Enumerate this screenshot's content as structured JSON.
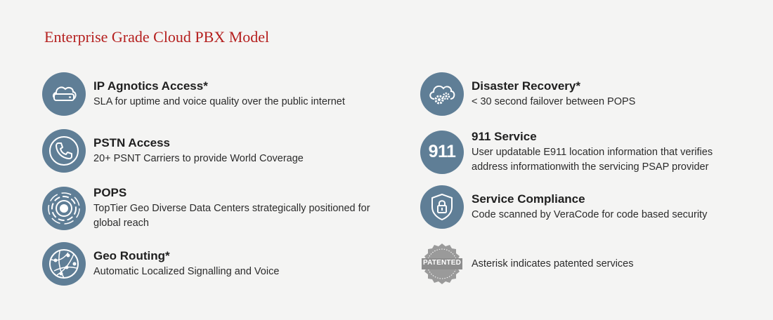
{
  "page": {
    "title": "Enterprise Grade Cloud PBX Model"
  },
  "features_left": [
    {
      "icon": "cloud-drive-icon",
      "heading": "IP Agnotics Access*",
      "description": "SLA for uptime and voice quality over the public internet"
    },
    {
      "icon": "phone-icon",
      "heading": "PSTN Access",
      "description": "20+ PSNT Carriers to provide World Coverage"
    },
    {
      "icon": "radar-target-icon",
      "heading": "POPS",
      "description": "TopTier Geo Diverse Data Centers strategically positioned for global reach"
    },
    {
      "icon": "globe-network-icon",
      "heading": "Geo Routing*",
      "description": "Automatic Localized Signalling and Voice"
    }
  ],
  "features_right": [
    {
      "icon": "cloud-gears-icon",
      "heading": "Disaster Recovery*",
      "description": "< 30 second failover between POPS"
    },
    {
      "icon": "911-icon",
      "icon_text": "911",
      "heading": "911 Service",
      "description": "User updatable E911 location information that verifies address informationwith the servicing PSAP provider"
    },
    {
      "icon": "shield-lock-icon",
      "heading": "Service Compliance",
      "description": "Code scanned by VeraCode for code based security"
    },
    {
      "icon": "patented-badge-icon",
      "icon_text": "PATENTED",
      "heading": "",
      "description": "Asterisk indicates patented services"
    }
  ],
  "colors": {
    "icon_bg": "#5f7e96",
    "title": "#b5201f",
    "badge": "#9a9a9a",
    "background": "#f4f4f3"
  }
}
